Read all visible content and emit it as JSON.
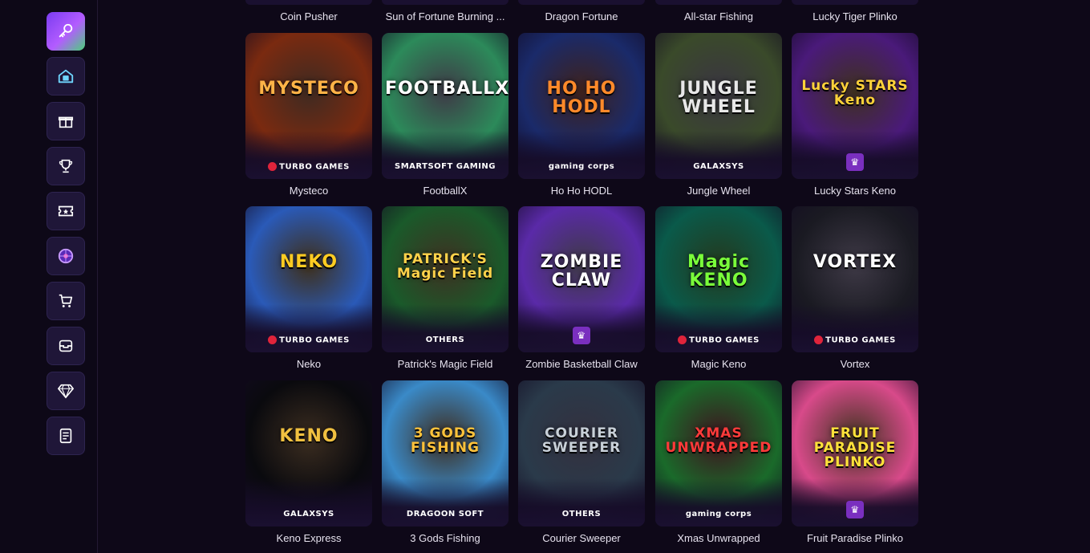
{
  "sidebar": {
    "items": [
      {
        "icon": "key-heart-icon",
        "active": true
      },
      {
        "icon": "home-icon"
      },
      {
        "icon": "gift-icon"
      },
      {
        "icon": "trophy-icon"
      },
      {
        "icon": "ticket-icon"
      },
      {
        "icon": "wheel-icon"
      },
      {
        "icon": "cart-icon"
      },
      {
        "icon": "inbox-icon"
      },
      {
        "icon": "diamond-icon"
      },
      {
        "icon": "document-icon"
      }
    ]
  },
  "top_row_titles": [
    "Coin Pusher",
    "Sun of Fortune Burning ...",
    "Dragon Fortune",
    "All-star Fishing",
    "Lucky Tiger Plinko"
  ],
  "games": [
    {
      "title": "Mysteco",
      "art_text": "MYSTECO",
      "provider": "TURBO GAMES",
      "bg": "#7a2a10",
      "accent": "#ffb347"
    },
    {
      "title": "FootballX",
      "art_text": "FOOTBALLX",
      "provider": "SMARTSOFT GAMING",
      "bg": "#2c8a5a",
      "accent": "#ffffff"
    },
    {
      "title": "Ho Ho HODL",
      "art_text": "HO HO HODL",
      "provider": "gaming corps",
      "bg": "#1a2a6a",
      "accent": "#ff8a2a"
    },
    {
      "title": "Jungle Wheel",
      "art_text": "JUNGLE WHEEL",
      "provider": "GALAXSYS",
      "bg": "#3a4a2a",
      "accent": "#e8e8e8"
    },
    {
      "title": "Lucky Stars Keno",
      "art_text": "Lucky STARS Keno",
      "provider": "",
      "bg": "#4a1a7a",
      "accent": "#ffd23a"
    },
    {
      "title": "Neko",
      "art_text": "NEKO",
      "provider": "TURBO GAMES",
      "bg": "#2a5ab8",
      "accent": "#ffcc22"
    },
    {
      "title": "Patrick's Magic Field",
      "art_text": "PATRICK'S Magic Field",
      "provider": "OTHERS",
      "bg": "#1a5a2a",
      "accent": "#ffd24a"
    },
    {
      "title": "Zombie Basketball Claw",
      "art_text": "ZOMBIE CLAW",
      "provider": "",
      "bg": "#5a2aa8",
      "accent": "#ffffff"
    },
    {
      "title": "Magic Keno",
      "art_text": "Magic KENO",
      "provider": "TURBO GAMES",
      "bg": "#0a5a4a",
      "accent": "#7aff3a"
    },
    {
      "title": "Vortex",
      "art_text": "VORTEX",
      "provider": "TURBO GAMES",
      "bg": "#1a1a22",
      "accent": "#ffffff"
    },
    {
      "title": "Keno Express",
      "art_text": "KENO",
      "provider": "GALAXSYS",
      "bg": "#0a0a0e",
      "accent": "#f0c040"
    },
    {
      "title": "3 Gods Fishing",
      "art_text": "3 GODS FISHING",
      "provider": "DRAGOON SOFT",
      "bg": "#3a8ac8",
      "accent": "#ffc23a"
    },
    {
      "title": "Courier Sweeper",
      "art_text": "COURIER SWEEPER",
      "provider": "OTHERS",
      "bg": "#2a3a4a",
      "accent": "#c8d0d8"
    },
    {
      "title": "Xmas Unwrapped",
      "art_text": "XMAS UNWRAPPED",
      "provider": "gaming corps",
      "bg": "#1a6a2a",
      "accent": "#ff3a3a"
    },
    {
      "title": "Fruit Paradise Plinko",
      "art_text": "FRUIT PARADISE PLINKO",
      "provider": "",
      "bg": "#d84a8a",
      "accent": "#ffe23a"
    }
  ]
}
